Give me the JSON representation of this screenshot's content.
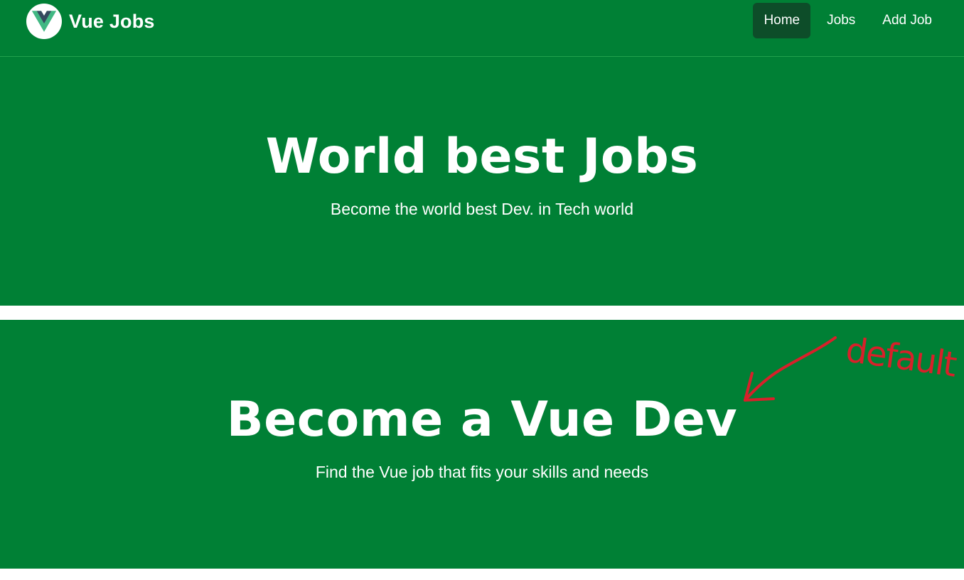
{
  "navbar": {
    "brand_text": "Vue Jobs",
    "logo_icon": "vue-logo-icon",
    "links": [
      {
        "label": "Home",
        "active": true
      },
      {
        "label": "Jobs",
        "active": false
      },
      {
        "label": "Add Job",
        "active": false
      }
    ]
  },
  "hero_primary": {
    "title": "World best Jobs",
    "subtitle": "Become the world best Dev. in Tech world"
  },
  "hero_secondary": {
    "title": "Become a Vue Dev",
    "subtitle": "Find the Vue job that fits your skills and needs"
  },
  "annotation": {
    "text": "default",
    "color": "#d8202a"
  },
  "colors": {
    "brand_green": "#008035",
    "active_nav": "#0d4d29",
    "vue_green": "#41b883",
    "vue_dark": "#34495e"
  }
}
